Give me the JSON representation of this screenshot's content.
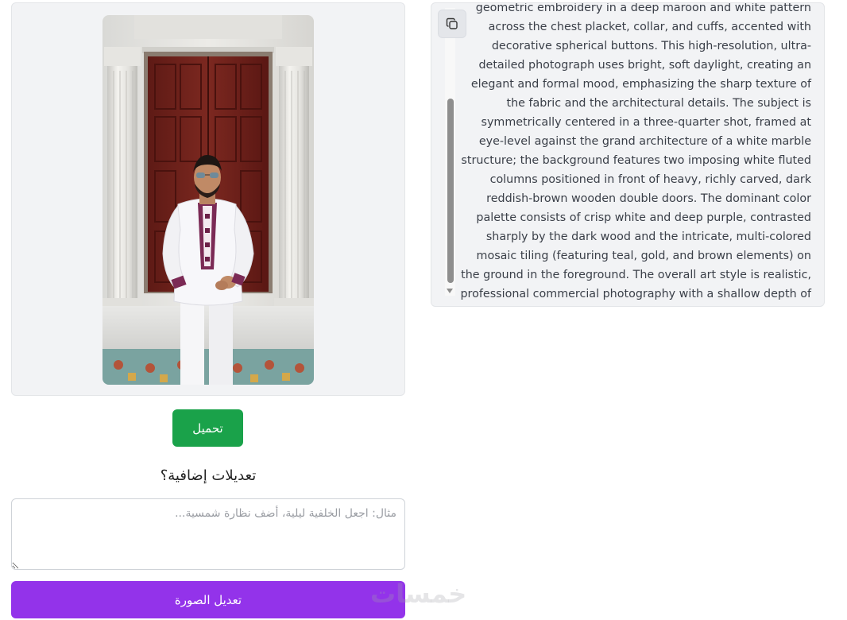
{
  "prompt_panel": {
    "text": "geometric embroidery in a deep maroon and white pattern across the chest placket, collar, and cuffs, accented with decorative spherical buttons. This high-resolution, ultra-detailed photograph uses bright, soft daylight, creating an elegant and formal mood, emphasizing the sharp texture of the fabric and the architectural details. The subject is symmetrically centered in a three-quarter shot, framed at eye-level against the grand architecture of a white marble structure; the background features two imposing white fluted columns positioned in front of heavy, richly carved, dark reddish-brown wooden double doors. The dominant color palette consists of crisp white and deep purple, contrasted sharply by the dark wood and the intricate, multi-colored mosaic tiling (featuring teal, gold, and brown elements) on the ground in the foreground. The overall art style is realistic, professional commercial photography with a shallow depth of field.",
    "copy_icon": "copy-icon"
  },
  "actions": {
    "download_label": "تحميل",
    "edits_heading": "تعديلات إضافية؟",
    "edits_placeholder": "مثال: اجعل الخلفية ليلية، أضف نظارة شمسية...",
    "edit_image_label": "تعديل الصورة"
  },
  "watermark": "خمسات",
  "colors": {
    "download": "#1aa24a",
    "edit_image": "#9333ea",
    "panel_bg": "#f2f3f5"
  }
}
